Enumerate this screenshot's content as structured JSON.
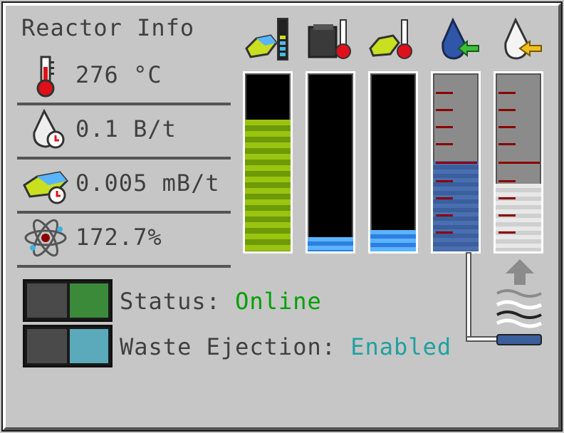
{
  "window": {
    "title": "Reactor Info"
  },
  "stats": {
    "temperature": "276 °C",
    "boil_rate": "0.1 B/t",
    "burn_rate": "0.005 mB/t",
    "efficiency": "172.7%"
  },
  "status": {
    "label": "Status:",
    "value": "Online",
    "value_color": "#00a000"
  },
  "waste_ejection": {
    "label": "Waste Ejection:",
    "value": "Enabled",
    "value_color": "#20a0a0"
  },
  "icons": {
    "temperature": "thermometer-icon",
    "boil_rate": "coolant-drop-clock-icon",
    "burn_rate": "fuel-clock-icon",
    "efficiency": "atom-icon",
    "tank_fuel": "fuel-gauge-icon",
    "tank_heated_coolant": "heated-block-icon",
    "tank_heated_fuel": "heated-fuel-icon",
    "tank_water_in": "water-drop-in-icon",
    "tank_steam_out": "steam-drop-out-icon"
  },
  "tanks": {
    "fuel": {
      "level": 0.74,
      "color": "#9bc410"
    },
    "coolant": {
      "level": 0.08,
      "color": "#5ab4ff"
    },
    "waste": {
      "level": 0.12,
      "color": "#5ab4ff"
    },
    "water": {
      "level": 0.51,
      "color": "#4a6fb0"
    },
    "steam": {
      "level": 0.38,
      "color": "#e8e8e8"
    }
  }
}
